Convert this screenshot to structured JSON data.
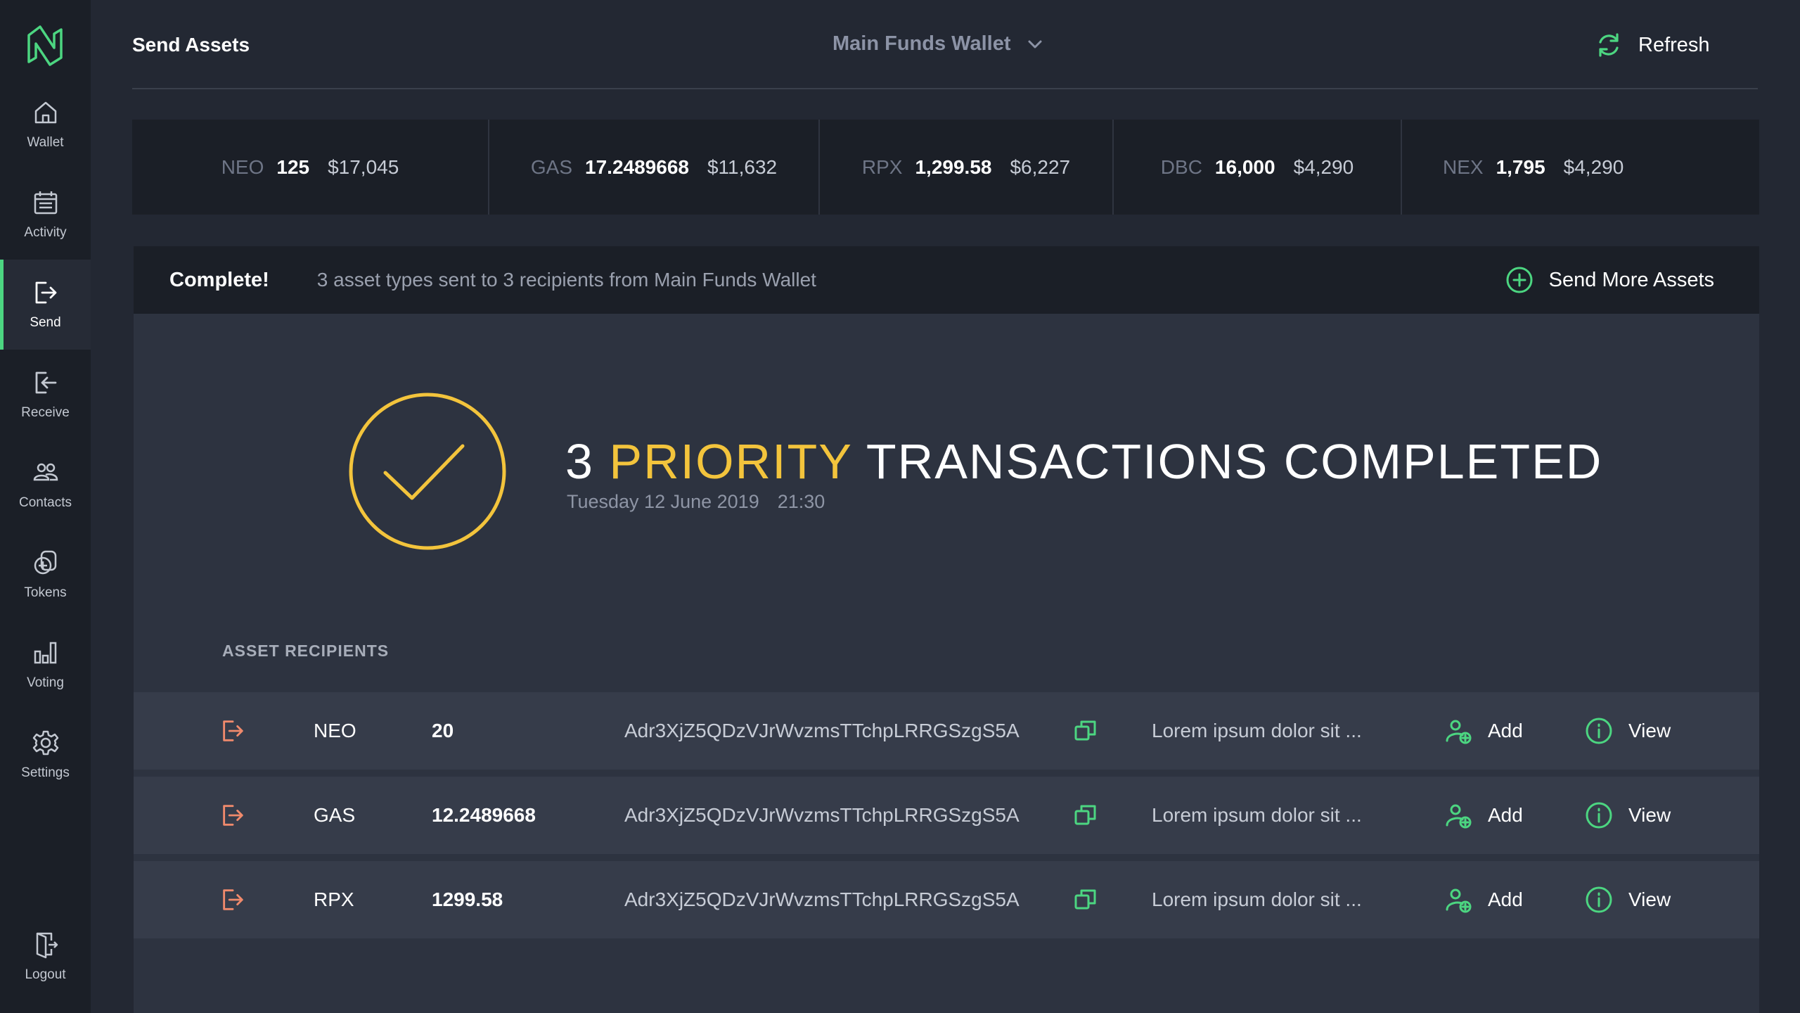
{
  "nav": {
    "items": [
      {
        "label": "Wallet",
        "icon": "home-icon"
      },
      {
        "label": "Activity",
        "icon": "calendar-icon"
      },
      {
        "label": "Send",
        "icon": "send-icon",
        "active": true
      },
      {
        "label": "Receive",
        "icon": "receive-icon"
      },
      {
        "label": "Contacts",
        "icon": "contacts-icon"
      },
      {
        "label": "Tokens",
        "icon": "tokens-icon"
      },
      {
        "label": "Voting",
        "icon": "bar-chart-icon"
      },
      {
        "label": "Settings",
        "icon": "gear-icon"
      }
    ],
    "logout": "Logout"
  },
  "header": {
    "title": "Send Assets",
    "wallet": "Main Funds Wallet",
    "refresh": "Refresh"
  },
  "balances": [
    {
      "symbol": "NEO",
      "amount": "125",
      "usd": "$17,045"
    },
    {
      "symbol": "GAS",
      "amount": "17.2489668",
      "usd": "$11,632"
    },
    {
      "symbol": "RPX",
      "amount": "1,299.58",
      "usd": "$6,227"
    },
    {
      "symbol": "DBC",
      "amount": "16,000",
      "usd": "$4,290"
    },
    {
      "symbol": "NEX",
      "amount": "1,795",
      "usd": "$4,290"
    }
  ],
  "complete": {
    "title": "Complete!",
    "message": "3 asset types sent to 3 recipients from Main Funds Wallet",
    "send_more": "Send More Assets"
  },
  "result": {
    "count": "3",
    "priority": "PRIORITY",
    "rest": "TRANSACTIONS COMPLETED",
    "date": "Tuesday 12 June 2019",
    "time": "21:30"
  },
  "recipients": {
    "title": "ASSET RECIPIENTS",
    "add_label": "Add",
    "view_label": "View",
    "rows": [
      {
        "asset": "NEO",
        "amount": "20",
        "address": "Adr3XjZ5QDzVJrWvzmsTTchpLRRGSzgS5A",
        "note": "Lorem ipsum dolor sit ..."
      },
      {
        "asset": "GAS",
        "amount": "12.2489668",
        "address": "Adr3XjZ5QDzVJrWvzmsTTchpLRRGSzgS5A",
        "note": "Lorem ipsum dolor sit ..."
      },
      {
        "asset": "RPX",
        "amount": "1299.58",
        "address": "Adr3XjZ5QDzVJrWvzmsTTchpLRRGSzgS5A",
        "note": "Lorem ipsum dolor sit ..."
      }
    ]
  },
  "colors": {
    "accent_green": "#4cd681",
    "accent_yellow": "#f3c43c",
    "send_orange": "#f08a6c",
    "background": "#232833",
    "sidebar": "#1b1f27"
  }
}
